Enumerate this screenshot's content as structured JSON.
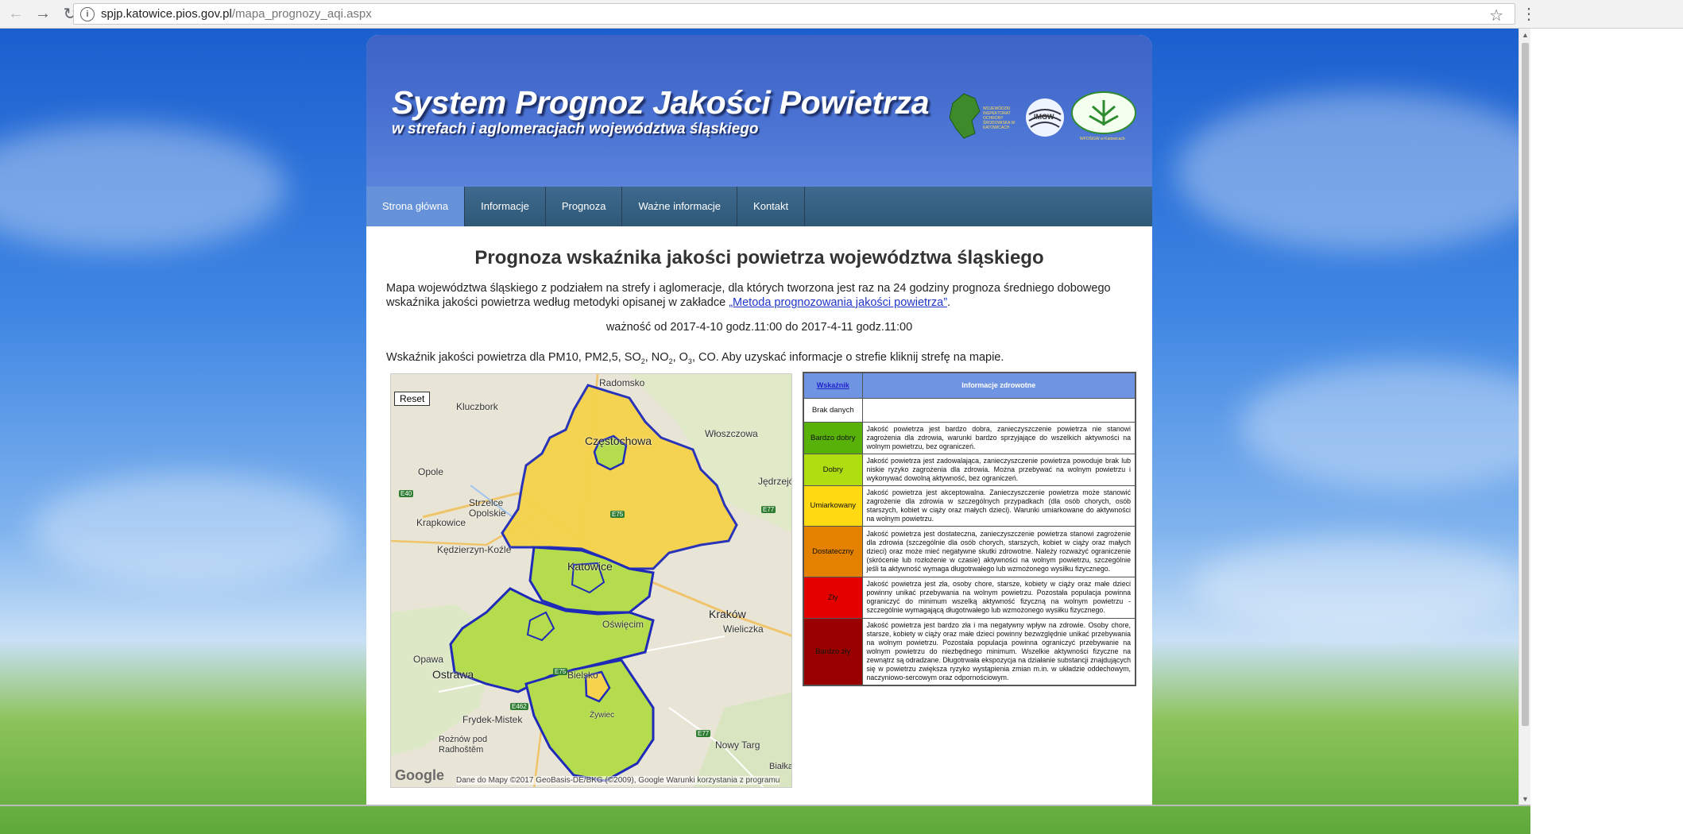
{
  "browser": {
    "url_host": "spjp.katowice.pios.gov.pl",
    "url_path": "/mapa_prognozy_aqi.aspx"
  },
  "header": {
    "title": "System Prognoz Jakości Powietrza",
    "subtitle": "w strefach i aglomeracjach województwa śląskiego",
    "logo_text_1": "WOJEWÓDZKI INSPEKTORAT OCHRONY ŚRODOWISKA W KATOWICACH",
    "logo_text_2": "IMGW",
    "logo_text_3": "WFOŚiGW w Katowicach"
  },
  "nav": {
    "items": [
      "Strona główna",
      "Informacje",
      "Prognoza",
      "Ważne informacje",
      "Kontakt"
    ]
  },
  "content": {
    "heading": "Prognoza wskaźnika jakości powietrza województwa śląskiego",
    "intro_text": "Mapa województwa śląskiego z podziałem na strefy i aglomeracje, dla których tworzona jest raz na 24 godziny prognoza średniego dobowego wskaźnika jakości powietrza według metodyki opisanej w zakładce ",
    "intro_link": "„Metoda prognozowania jakości powietrza”",
    "intro_end": ".",
    "validity": "ważność od 2017-4-10 godz.11:00 do 2017-4-11 godz.11:00",
    "pollutants_prefix": "Wskaźnik jakości powietrza dla PM10, PM2,5, SO",
    "pollutants_mid1": ", NO",
    "pollutants_mid2": ", O",
    "pollutants_suffix": ", CO. Aby uzyskać informacje o strefie kliknij strefę na mapie.",
    "sub_2": "2",
    "sub_3": "3"
  },
  "map": {
    "reset_label": "Reset",
    "google_label": "Google",
    "attribution": "Dane do Mapy ©2017 GeoBasis-DE/BKG (©2009), Google    Warunki korzystania z programu",
    "cities": [
      "Radomsko",
      "Kluczbork",
      "Częstochowa",
      "Włoszczowa",
      "Opole",
      "Jędrzejó",
      "Strzelce Opolskie",
      "Krapkowice",
      "Kędzierzyn-Koźle",
      "Katowice",
      "Kraków",
      "Wieliczka",
      "Oświęcim",
      "Opawa",
      "Ostrawa",
      "Bielsko",
      "Frydek-Mistek",
      "Nowy Targ",
      "Rożnów pod Radhoštěm",
      "Białka",
      "Żywiec"
    ],
    "roads": [
      "E40",
      "E75",
      "E77",
      "E462",
      "E75",
      "E77"
    ]
  },
  "legend": {
    "header_index": "Wskaźnik",
    "header_info": "Informacje zdrowotne",
    "rows": [
      {
        "label": "Brak danych",
        "color": "#ffffff",
        "text": ""
      },
      {
        "label": "Bardzo dobry",
        "color": "#57b108",
        "text": "Jakość powietrza jest bardzo dobra, zanieczyszczenie powietrza nie stanowi zagrożenia dla zdrowia, warunki bardzo sprzyjające do wszelkich aktywności na wolnym powietrzu, bez ograniczeń."
      },
      {
        "label": "Dobry",
        "color": "#b0dd10",
        "text": "Jakość powietrza jest zadowalająca, zanieczyszczenie powietrza powoduje brak lub niskie ryzyko zagrożenia dla zdrowia. Można przebywać na wolnym powietrzu i wykonywać dowolną aktywność, bez ograniczeń."
      },
      {
        "label": "Umiarkowany",
        "color": "#ffd911",
        "text": "Jakość powietrza jest akceptowalna. Zanieczyszczenie powietrza może stanowić zagrożenie dla zdrowia w szczególnych przypadkach (dla osób chorych, osób starszych, kobiet w ciąży oraz małych dzieci). Warunki umiarkowane do aktywności na wolnym powietrzu."
      },
      {
        "label": "Dostateczny",
        "color": "#e58100",
        "text": "Jakość powietrza jest dostateczna, zanieczyszczenie powietrza stanowi zagrożenie dla zdrowia (szczególnie dla osób chorych, starszych, kobiet w ciąży oraz małych dzieci) oraz może mieć negatywne skutki zdrowotne. Należy rozważyć ograniczenie (skrócenie lub rozłożenie w czasie) aktywności na wolnym powietrzu, szczególnie jeśli ta aktywność wymaga długotrwałego lub wzmożonego wysiłku fizycznego."
      },
      {
        "label": "Zły",
        "color": "#e50000",
        "text": "Jakość powietrza jest zła, osoby chore, starsze, kobiety w ciąży oraz małe dzieci powinny unikać przebywania na wolnym powietrzu. Pozostała populacja powinna ograniczyć do minimum wszelką aktywność fizyczną na wolnym powietrzu - szczególnie wymagającą długotrwałego lub wzmożonego wysiłku fizycznego."
      },
      {
        "label": "Bardzo zły",
        "color": "#990000",
        "text": "Jakość powietrza jest bardzo zła i ma negatywny wpływ na zdrowie. Osoby chore, starsze, kobiety w ciąży oraz małe dzieci powinny bezwzględnie unikać przebywania na wolnym powietrzu. Pozostała populacja powinna ograniczyć przebywanie na wolnym powietrzu do niezbędnego minimum. Wszelkie aktywności fizyczne na zewnątrz są odradzane. Długotrwała ekspozycja na działanie substancji znajdujących się w powietrzu zwiększa ryzyko wystąpienia zmian m.in. w układzie oddechowym, naczyniowo-sercowym oraz odpornościowym."
      }
    ]
  },
  "colors": {
    "zone_moderate": "#f5d34a",
    "zone_good": "#b5dc4c",
    "zone_border": "#1f2bb8"
  }
}
